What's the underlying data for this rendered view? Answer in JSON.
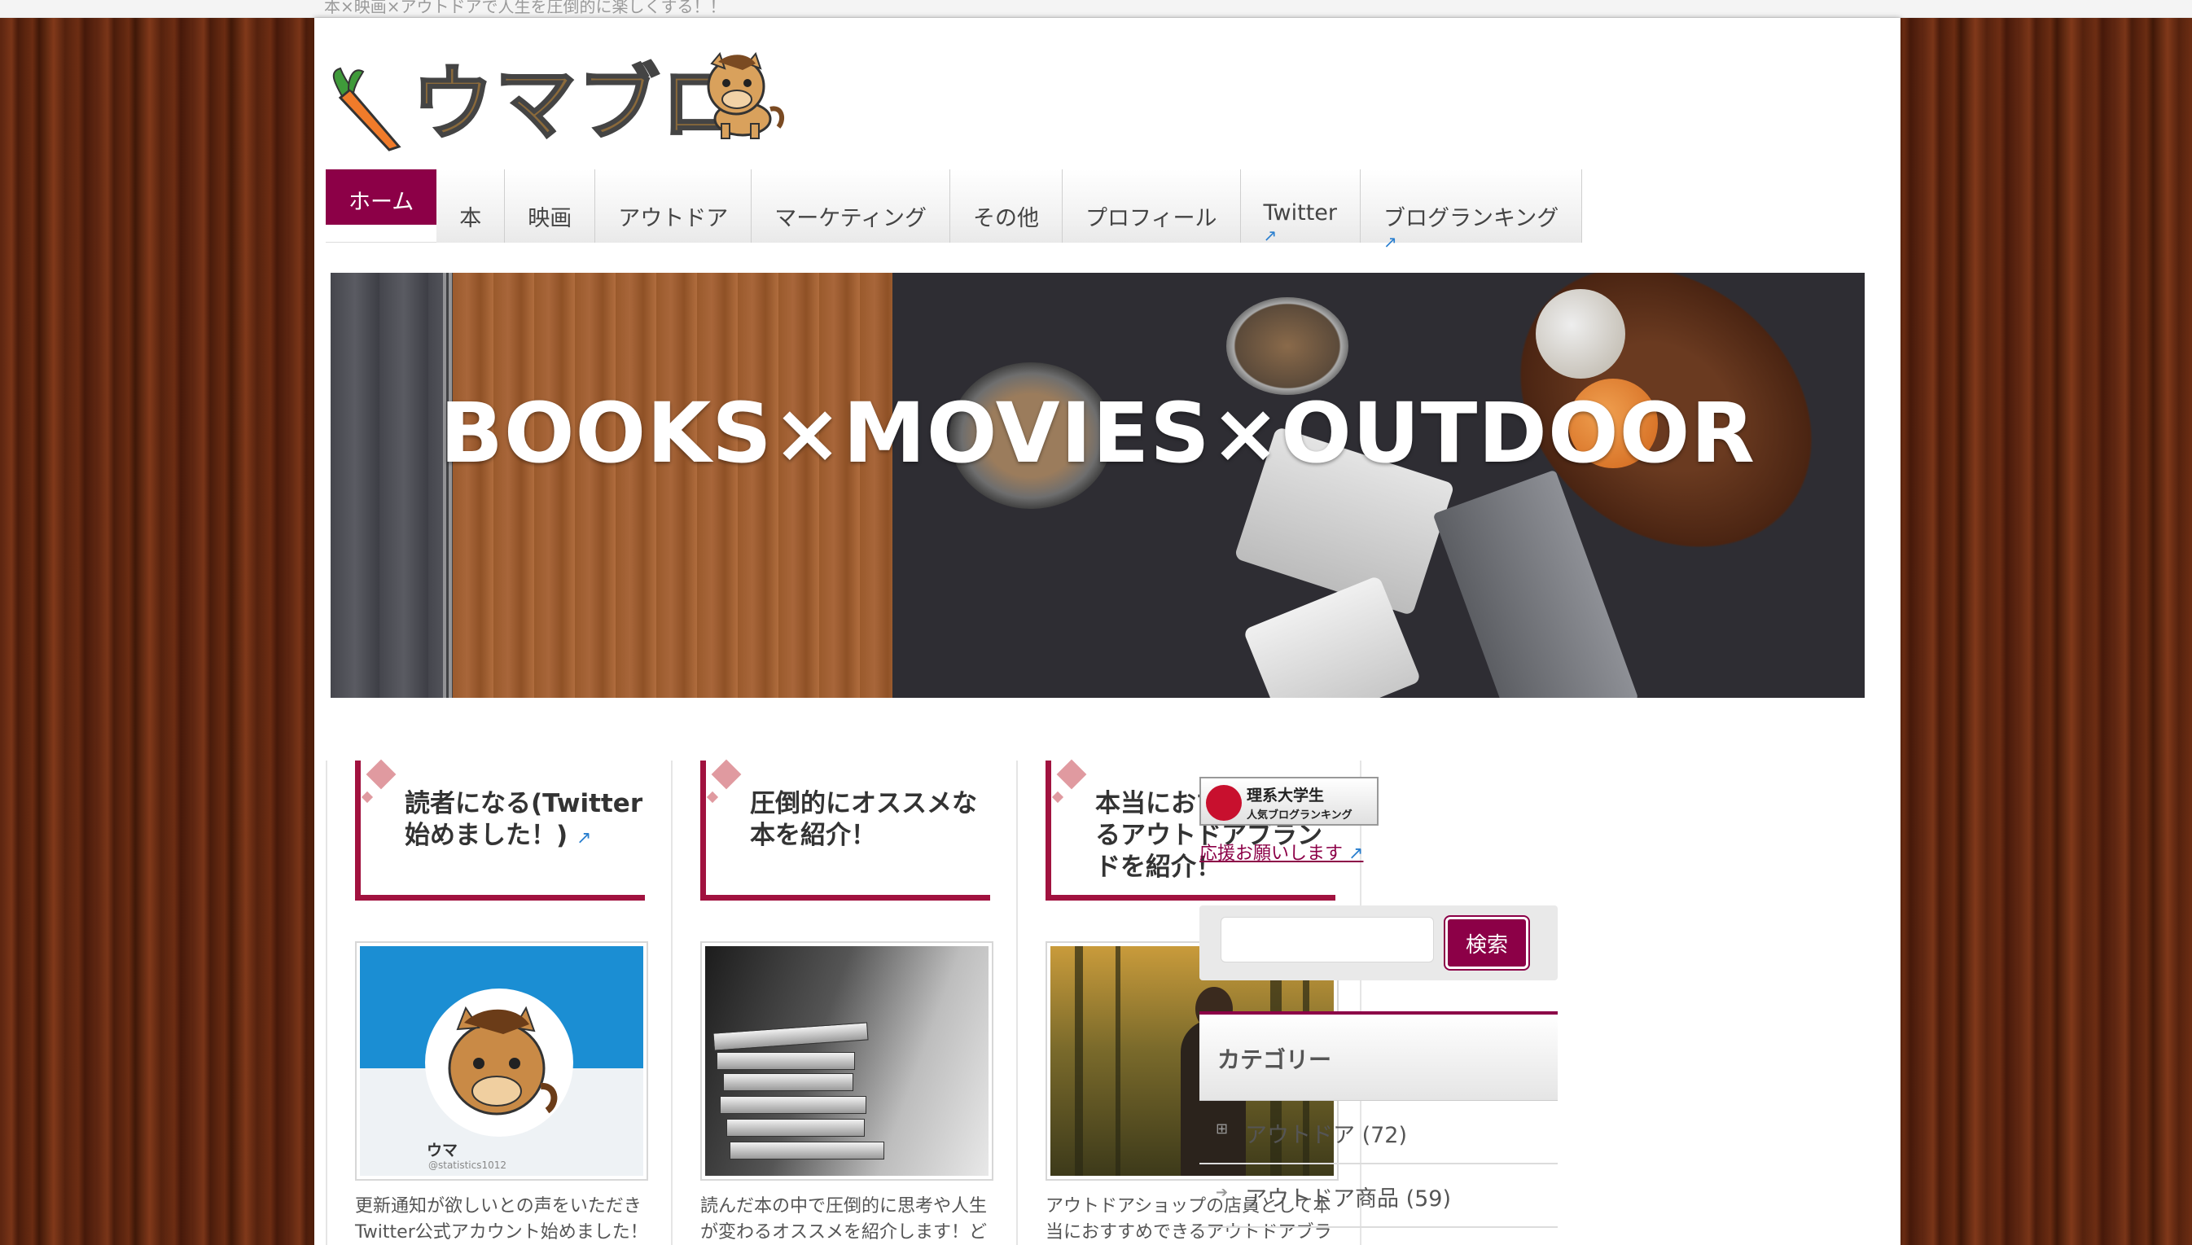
{
  "site": {
    "tagline": "本×映画×アウトドアで人生を圧倒的に楽しくする！！",
    "logo_text": "ウマブロ"
  },
  "nav": {
    "items": [
      {
        "label": "ホーム",
        "active": true,
        "external": false
      },
      {
        "label": "本",
        "active": false,
        "external": false
      },
      {
        "label": "映画",
        "active": false,
        "external": false
      },
      {
        "label": "アウトドア",
        "active": false,
        "external": false
      },
      {
        "label": "マーケティング",
        "active": false,
        "external": false
      },
      {
        "label": "その他",
        "active": false,
        "external": false
      },
      {
        "label": "プロフィール",
        "active": false,
        "external": false
      },
      {
        "label": "Twitter",
        "active": false,
        "external": true
      },
      {
        "label": "ブログランキング",
        "active": false,
        "external": true
      }
    ]
  },
  "hero": {
    "text": "BOOKS×MOVIES×OUTDOOR"
  },
  "columns": [
    {
      "title": "読者になる(Twitter始めました！)",
      "external": true,
      "description": "更新通知が欲しいとの声をいただきTwitter公式アカウント始めました！フォローお待ちしてま",
      "card_name": "ウマ",
      "card_handle": "@statistics1012"
    },
    {
      "title": "圧倒的にオススメな本を紹介！",
      "external": false,
      "description": "読んだ本の中で圧倒的に思考や人生が変わるオススメを紹介します！どんどん更新します！"
    },
    {
      "title": "本当におすすめできるアウトドアブランドを紹介！",
      "external": false,
      "description": "アウトドアショップの店員として本当におすすめできるアウトドアブランドを紹介します！"
    }
  ],
  "sidebar": {
    "ranking_banner_line1": "理系大学生",
    "ranking_banner_line2": "人気ブログランキング",
    "support_link": "応援お願いします",
    "search": {
      "placeholder": "",
      "button_label": "検索"
    },
    "categories_title": "カテゴリー",
    "categories": [
      {
        "label": "アウトドア (72)",
        "icon": "expand-plus-icon"
      },
      {
        "label": "アウトドア商品 (59)",
        "icon": "arrow-right-icon"
      }
    ]
  },
  "colors": {
    "accent": "#8c0047",
    "heading_border": "#a1123f",
    "link_external": "#2a7fcf"
  }
}
